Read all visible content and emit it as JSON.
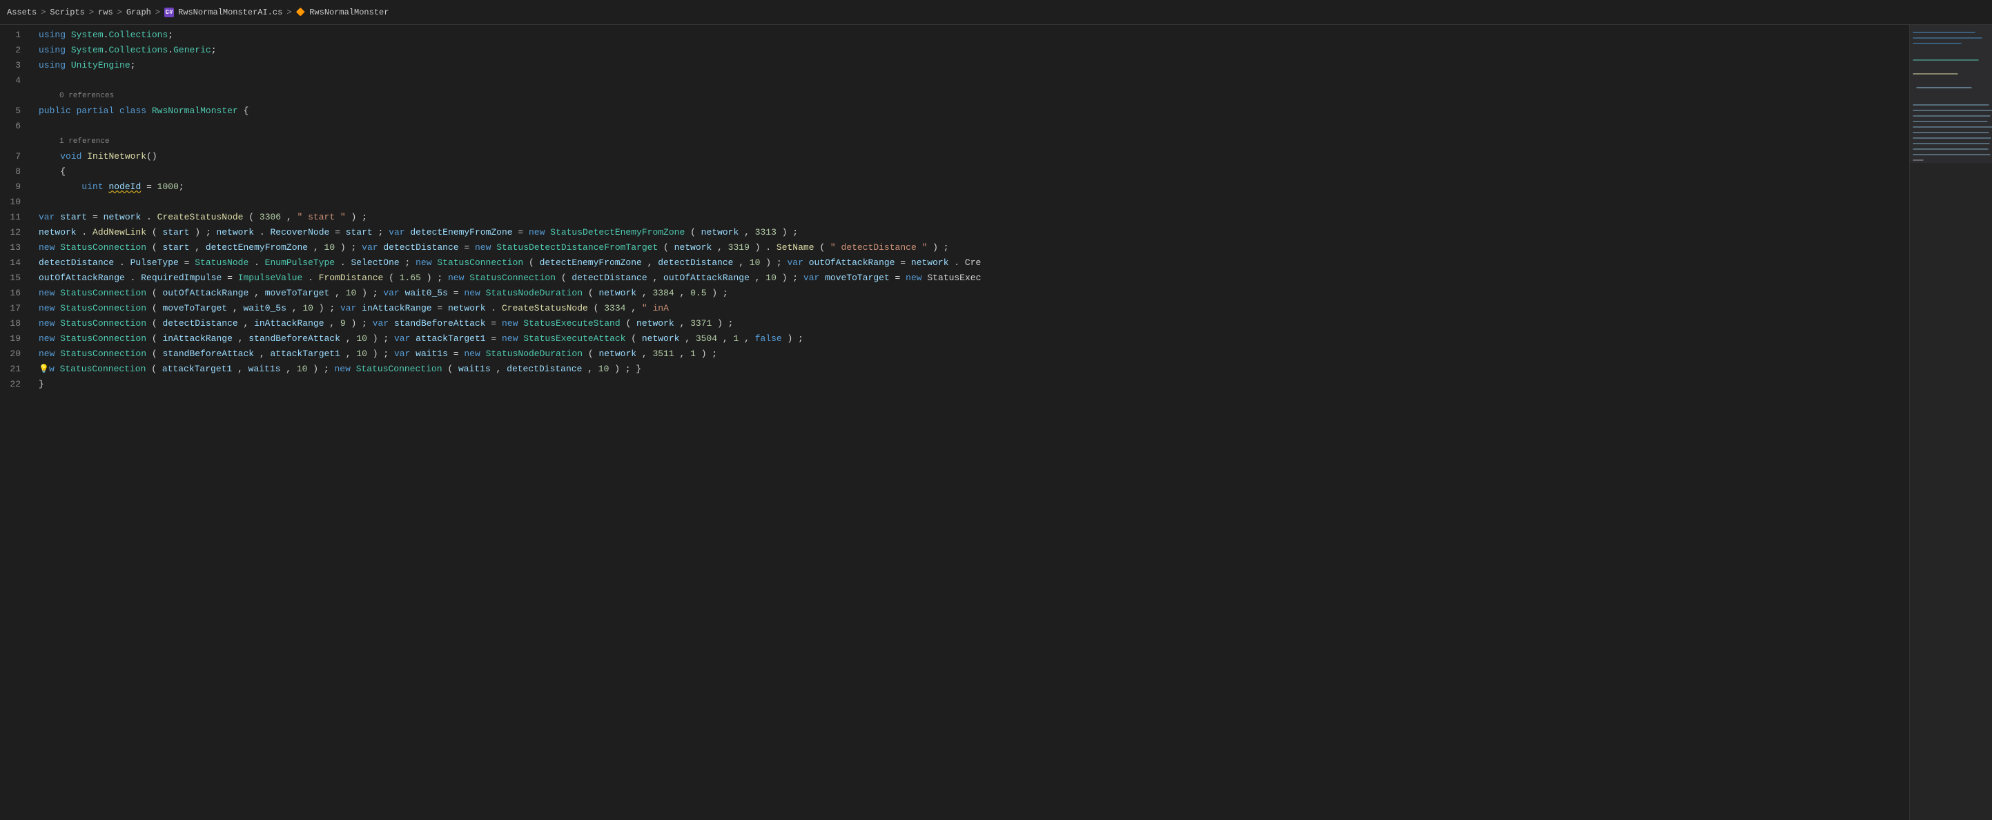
{
  "breadcrumb": {
    "parts": [
      "Assets",
      "Scripts",
      "rws",
      "Graph",
      "RwsNormalMonsterAI.cs",
      "RwsNormalMonster"
    ],
    "separators": [
      ">",
      ">",
      ">",
      ">",
      ">"
    ]
  },
  "editor": {
    "title": "RwsNormalMonsterAI.cs",
    "lines": [
      {
        "num": 1,
        "content": "using System.Collections;"
      },
      {
        "num": 2,
        "content": "using System.Collections.Generic;"
      },
      {
        "num": 3,
        "content": "using UnityEngine;"
      },
      {
        "num": 4,
        "content": ""
      },
      {
        "num": 5,
        "content": "0 references",
        "meta": true
      },
      {
        "num": 5,
        "content": "public partial class RwsNormalMonster {"
      },
      {
        "num": 6,
        "content": ""
      },
      {
        "num": 7,
        "content": "1 reference",
        "meta": true
      },
      {
        "num": 7,
        "content": "    void InitNetwork()"
      },
      {
        "num": 8,
        "content": "    {"
      },
      {
        "num": 9,
        "content": "        uint nodeId = 1000;"
      },
      {
        "num": 10,
        "content": ""
      },
      {
        "num": 11,
        "content": "var start = network . CreateStatusNode ( 3306 , \" start \" ) ;"
      },
      {
        "num": 12,
        "content": "network . AddNewLink ( start ) ; network . RecoverNode = start ; var detectEnemyFromZone = new StatusDetectEnemyFromZone ( network , 3313 ) ;"
      },
      {
        "num": 13,
        "content": "new StatusConnection ( start , detectEnemyFromZone , 10 ) ; var detectDistance = new StatusDetectDistanceFromTarget ( network , 3319 ) . SetName ( \" detectDistance \" ) ;"
      },
      {
        "num": 14,
        "content": "detectDistance . PulseType = StatusNode . EnumPulseType . SelectOne ; new StatusConnection ( detectEnemyFromZone , detectDistance , 10 ) ; var outOfAttackRange = network . Cre"
      },
      {
        "num": 15,
        "content": "outOfAttackRange . RequiredImpulse = ImpulseValue . FromDistance ( 1.65 ) ; new StatusConnection ( detectDistance , outOfAttackRange , 10 ) ; var moveToTarget = new StatusExec"
      },
      {
        "num": 16,
        "content": "new StatusConnection ( outOfAttackRange , moveToTarget , 10 ) ; var wait0_5s = new StatusNodeDuration ( network , 3384 , 0.5 ) ;"
      },
      {
        "num": 17,
        "content": "new StatusConnection ( moveToTarget , wait0_5s , 10 ) ; var inAttackRange = network . CreateStatusNode ( 3334 , \" inA"
      },
      {
        "num": 18,
        "content": "new StatusConnection ( detectDistance , inAttackRange , 9 ) ; var standBeforeAttack = new StatusExecuteStand ( network , 3371 ) ;"
      },
      {
        "num": 19,
        "content": "new StatusConnection ( inAttackRange , standBeforeAttack , 10 ) ; var attackTarget1 = new StatusExecuteAttack ( network , 3504 , 1 , false ) ;"
      },
      {
        "num": 20,
        "content": "new StatusConnection ( standBeforeAttack , attackTarget1 , 10 ) ; var wait1s = new StatusNodeDuration ( network , 3511 , 1 ) ;"
      },
      {
        "num": 21,
        "content": "new StatusConnection ( attackTarget1 , wait1s , 10 ) ; new StatusConnection ( wait1s , detectDistance , 10 ) ; }"
      },
      {
        "num": 22,
        "content": "}"
      }
    ]
  }
}
